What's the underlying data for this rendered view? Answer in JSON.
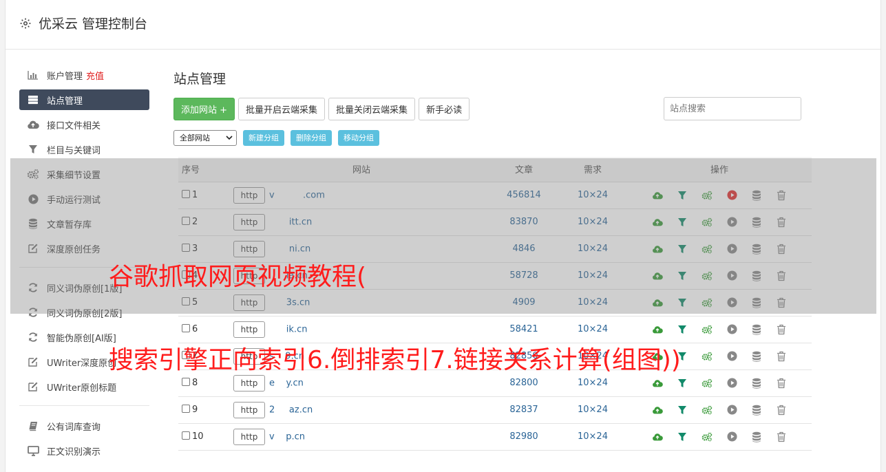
{
  "app": {
    "title": "优采云 管理控制台"
  },
  "sidebar": {
    "group1": [
      {
        "label": "账户管理",
        "extra": "充值",
        "icon": "bar-chart-icon",
        "active": false
      },
      {
        "label": "站点管理",
        "icon": "server-icon",
        "active": true
      },
      {
        "label": "接口文件相关",
        "icon": "cloud-upload-icon",
        "active": false
      },
      {
        "label": "栏目与关键词",
        "icon": "filter-icon",
        "active": false
      },
      {
        "label": "采集细节设置",
        "icon": "gears-icon",
        "active": false
      },
      {
        "label": "手动运行测试",
        "icon": "play-icon",
        "active": false
      },
      {
        "label": "文章暂存库",
        "icon": "database-icon",
        "active": false
      },
      {
        "label": "深度原创任务",
        "icon": "edit-icon",
        "active": false
      }
    ],
    "group2": [
      {
        "label": "同义词伪原创[1版]",
        "icon": "refresh-icon"
      },
      {
        "label": "同义词伪原创[2版]",
        "icon": "refresh-icon"
      },
      {
        "label": "智能伪原创[AI版]",
        "icon": "refresh-icon"
      },
      {
        "label": "UWriter深度原创",
        "icon": "edit-icon"
      },
      {
        "label": "UWriter原创标题",
        "icon": "edit-icon"
      }
    ],
    "group3": [
      {
        "label": "公有词库查询",
        "icon": "book-icon"
      },
      {
        "label": "正文识别演示",
        "icon": "monitor-icon"
      }
    ]
  },
  "main": {
    "title": "站点管理",
    "buttons": {
      "add": "添加网站 +",
      "batch_open": "批量开启云端采集",
      "batch_close": "批量关闭云端采集",
      "guide": "新手必读"
    },
    "search_placeholder": "站点搜索",
    "group_select": "全部网站",
    "group_buttons": {
      "new": "新建分组",
      "delete": "删除分组",
      "move": "移动分组"
    },
    "table": {
      "headers": {
        "index": "序号",
        "site": "网站",
        "articles": "文章",
        "demand": "需求",
        "ops": "操作"
      },
      "http_label": "http",
      "rows": [
        {
          "index": "1",
          "domain": "v          .com",
          "articles": "456814",
          "demand": "10×24",
          "play_active": true
        },
        {
          "index": "2",
          "domain": "       itt.cn",
          "articles": "83870",
          "demand": "10×24",
          "play_active": false
        },
        {
          "index": "3",
          "domain": "       ni.cn",
          "articles": "4846",
          "demand": "10×24",
          "play_active": false
        },
        {
          "index": "4",
          "domain": "      ia.cn",
          "articles": "58728",
          "demand": "10×24",
          "play_active": false
        },
        {
          "index": "5",
          "domain": "      3s.cn",
          "articles": "4909",
          "demand": "10×24",
          "play_active": false
        },
        {
          "index": "6",
          "domain": "      ik.cn",
          "articles": "58421",
          "demand": "10×24",
          "play_active": false
        },
        {
          "index": "7",
          "domain": "s    9.cn",
          "articles": "82850",
          "demand": "10×24",
          "play_active": false
        },
        {
          "index": "8",
          "domain": "e    y.cn",
          "articles": "82800",
          "demand": "10×24",
          "play_active": false
        },
        {
          "index": "9",
          "domain": "2     az.cn",
          "articles": "82837",
          "demand": "10×24",
          "play_active": false
        },
        {
          "index": "10",
          "domain": "v    p.cn",
          "articles": "82980",
          "demand": "10×24",
          "play_active": false
        }
      ]
    }
  },
  "watermark": {
    "line1": "谷歌抓取网页视频教程(",
    "line2": "搜索引擎正向索引6.倒排索引7.链接关系计算(组图))"
  },
  "colors": {
    "green": "#3a9a3a",
    "teal": "#128a6a",
    "red": "#e03030",
    "gray": "#888888",
    "active_nav": "#3f4a5c"
  }
}
